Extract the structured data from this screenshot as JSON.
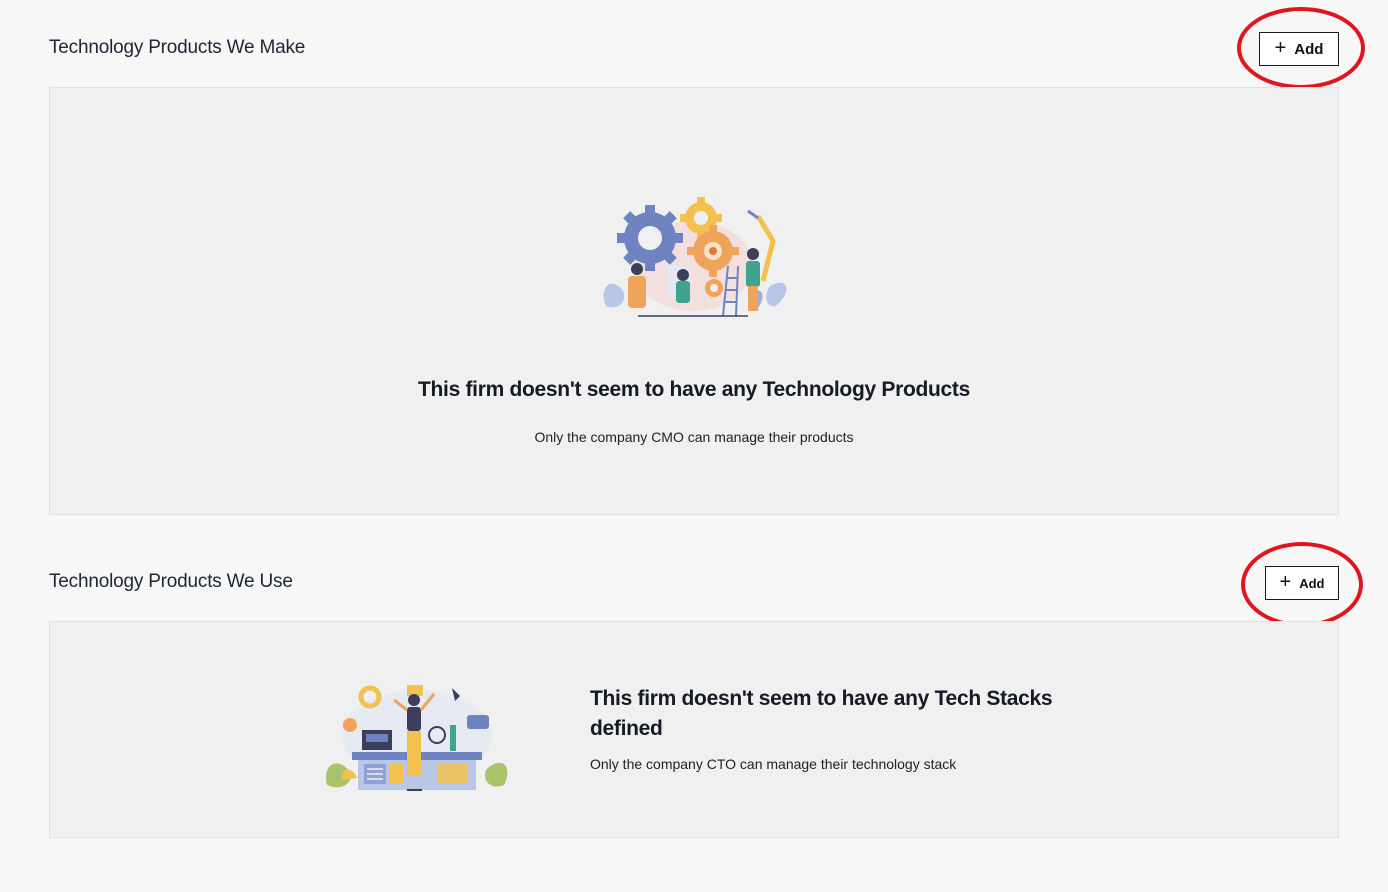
{
  "sections": {
    "make": {
      "title": "Technology Products We Make",
      "add_label": "Add",
      "empty_title": "This firm doesn't seem to have any Technology Products",
      "empty_subtitle": "Only the company CMO can manage their products"
    },
    "use": {
      "title": "Technology Products We Use",
      "add_label": "Add",
      "empty_title": "This firm doesn't seem to have any Tech Stacks defined",
      "empty_subtitle": "Only the company CTO can manage their technology stack"
    }
  },
  "icons": {
    "add": "plus-icon",
    "illustration_make": "gears-team-illustration",
    "illustration_use": "workbench-tools-illustration"
  },
  "colors": {
    "background": "#f7f7f7",
    "panel": "#f0f0f0",
    "annotation": "#e0161c",
    "button_border": "#1a1a1a"
  }
}
